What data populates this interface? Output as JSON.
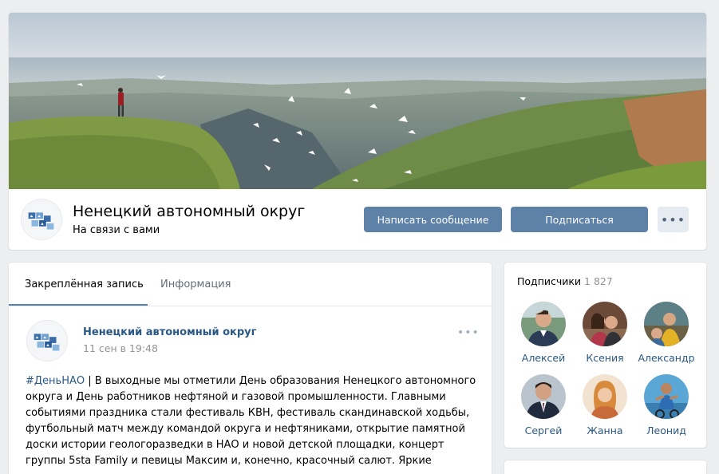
{
  "group": {
    "name": "Ненецкий автономный округ",
    "status": "На связи с вами",
    "buttons": {
      "message": "Написать сообщение",
      "subscribe": "Подписаться",
      "more": "•••"
    }
  },
  "wall": {
    "tabs": [
      {
        "label": "Закреплённая запись",
        "active": true
      },
      {
        "label": "Информация",
        "active": false
      }
    ],
    "post": {
      "author": "Ненецкий автономный округ",
      "date": "11 сен в 19:48",
      "more": "•••",
      "hashtag": "#ДеньНАО",
      "text": " | В выходные мы отметили День образования Ненецкого автономного округа и День работников нефтяной и газовой промышленности. Главными событиями праздника стали фестиваль КВН, фестиваль скандинавской ходьбы, футбольный матч между командой округа и нефтяниками, открытие памятной доски истории геологоразведки в НАО и новой детской площадки, концерт группы 5sta Family и певицы Максим и, конечно, красочный салют. Яркие"
    }
  },
  "subscribers": {
    "title": "Подписчики",
    "count": "1 827",
    "people": [
      {
        "name": "Алексей"
      },
      {
        "name": "Ксения"
      },
      {
        "name": "Александр"
      },
      {
        "name": "Сергей"
      },
      {
        "name": "Жанна"
      },
      {
        "name": "Леонид"
      }
    ]
  },
  "colors": {
    "accent": "#5e81a8",
    "link": "#2a5885",
    "background": "#edeef0"
  }
}
